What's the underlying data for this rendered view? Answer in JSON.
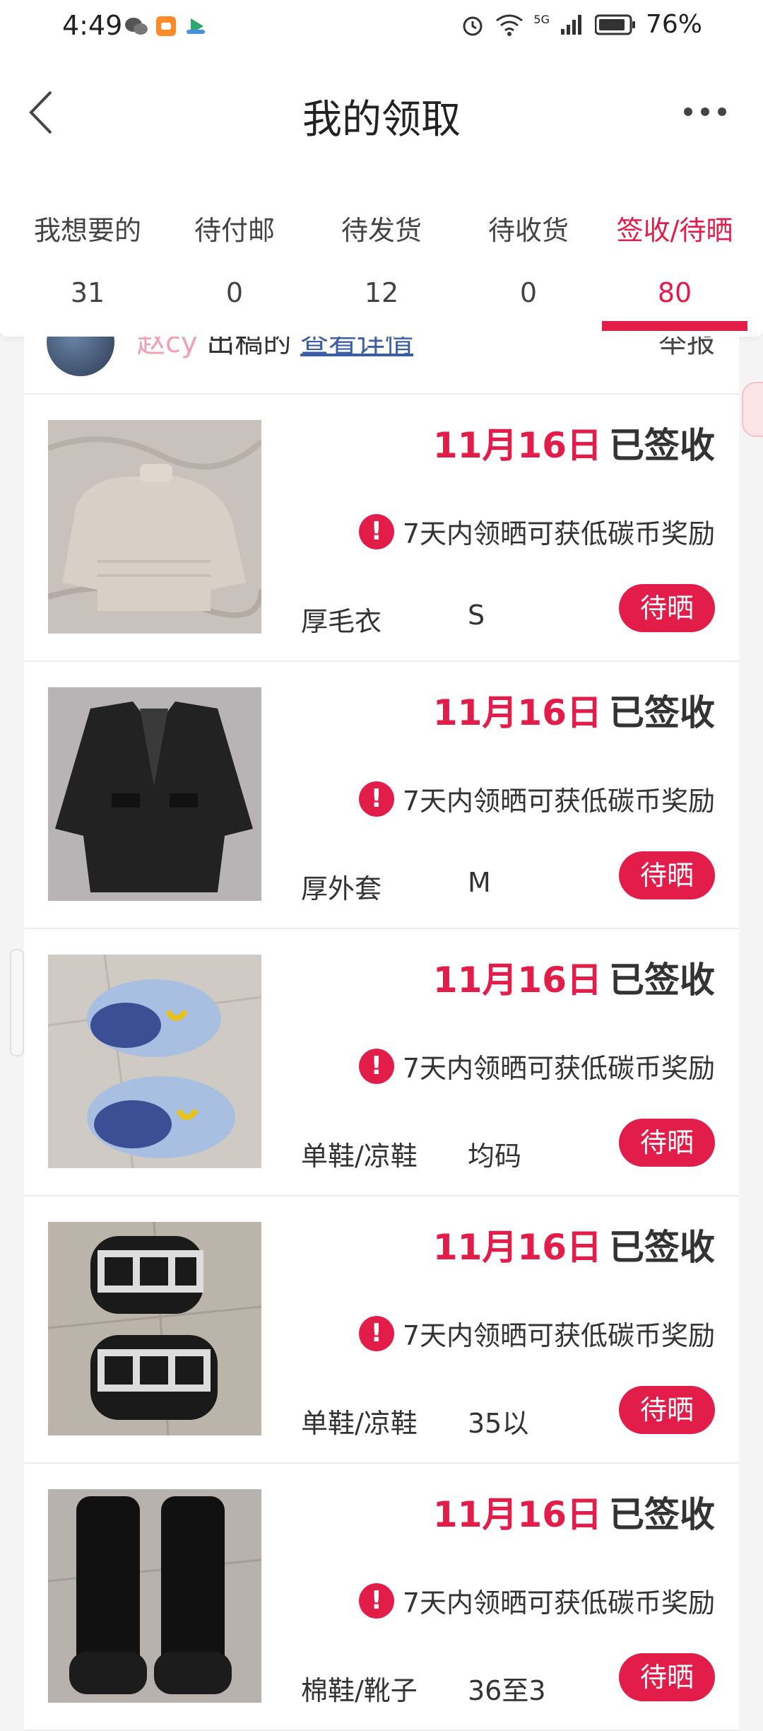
{
  "status_bar": {
    "time": "4:49",
    "battery": "76%",
    "network": "5G"
  },
  "header": {
    "title": "我的领取"
  },
  "tabs": [
    {
      "label": "我想要的",
      "count": "31"
    },
    {
      "label": "待付邮",
      "count": "0"
    },
    {
      "label": "待发货",
      "count": "12"
    },
    {
      "label": "待收货",
      "count": "0"
    },
    {
      "label": "签收/待晒",
      "count": "80",
      "active": true
    }
  ],
  "partial_item": {
    "name": "赵cy",
    "text": "出稿的",
    "link": "查看详情",
    "action": "举报"
  },
  "items": [
    {
      "date": "11月16日",
      "status": "已签收",
      "notice": "7天内领晒可获低碳币奖励",
      "category": "厚毛衣",
      "size": "S",
      "button": "待晒",
      "image": "sweater"
    },
    {
      "date": "11月16日",
      "status": "已签收",
      "notice": "7天内领晒可获低碳币奖励",
      "category": "厚外套",
      "size": "M",
      "button": "待晒",
      "image": "coat"
    },
    {
      "date": "11月16日",
      "status": "已签收",
      "notice": "7天内领晒可获低碳币奖励",
      "category": "单鞋/凉鞋",
      "size": "均码",
      "button": "待晒",
      "image": "slippers"
    },
    {
      "date": "11月16日",
      "status": "已签收",
      "notice": "7天内领晒可获低碳币奖励",
      "category": "单鞋/凉鞋",
      "size": "35以",
      "button": "待晒",
      "image": "sandals"
    },
    {
      "date": "11月16日",
      "status": "已签收",
      "notice": "7天内领晒可获低碳币奖励",
      "category": "棉鞋/靴子",
      "size": "36至3",
      "button": "待晒",
      "image": "boots"
    }
  ],
  "colors": {
    "accent": "#e21d4a"
  }
}
